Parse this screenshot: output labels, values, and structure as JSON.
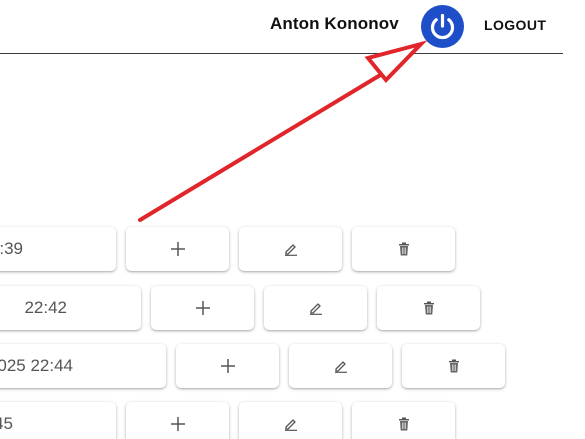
{
  "header": {
    "user_name": "Anton Kononov",
    "logout_label": "LOGOUT",
    "power_icon": "power-icon",
    "accent_color": "#1e4fc9"
  },
  "rows": [
    {
      "date_fragment": ":39",
      "add_icon": "plus-icon",
      "edit_icon": "pencil-icon",
      "delete_icon": "trash-icon"
    },
    {
      "date_fragment": "22:42",
      "add_icon": "plus-icon",
      "edit_icon": "pencil-icon",
      "delete_icon": "trash-icon"
    },
    {
      "date_fragment": "025 22:44",
      "add_icon": "plus-icon",
      "edit_icon": "pencil-icon",
      "delete_icon": "trash-icon"
    },
    {
      "date_fragment": "45",
      "add_icon": "plus-icon",
      "edit_icon": "pencil-icon",
      "delete_icon": "trash-icon"
    }
  ],
  "annotation": {
    "type": "arrow",
    "color": "#e0262b",
    "points_to": "power-button"
  }
}
